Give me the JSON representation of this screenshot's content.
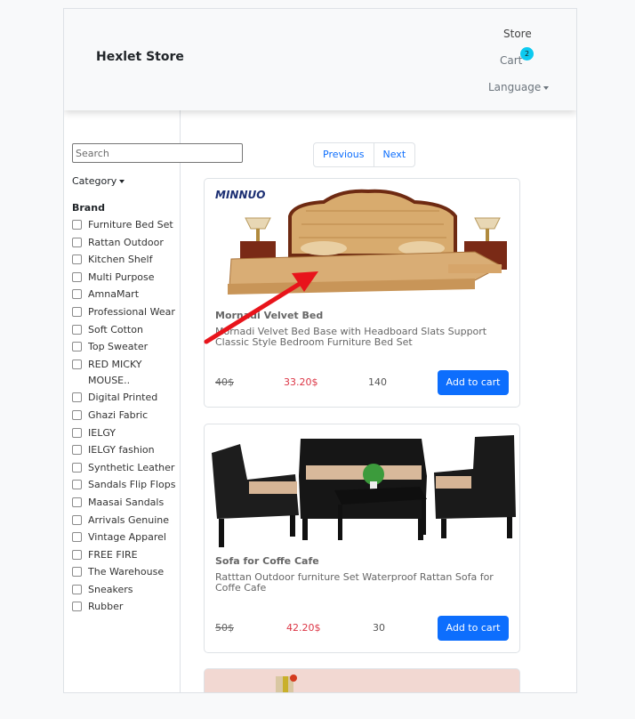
{
  "navbar": {
    "brand": "Hexlet Store",
    "store_link": "Store",
    "cart_link": "Cart",
    "cart_count": "2",
    "language_label": "Language"
  },
  "sidebar": {
    "search_placeholder": "Search",
    "category_label": "Category",
    "brand_heading": "Brand",
    "brands": [
      "Furniture Bed Set",
      "Rattan Outdoor",
      "Kitchen Shelf",
      "Multi Purpose",
      "AmnaMart",
      "Professional Wear",
      "Soft Cotton",
      "Top Sweater",
      "RED MICKY MOUSE..",
      "Digital Printed",
      "Ghazi Fabric",
      "IELGY",
      "IELGY fashion",
      "Synthetic Leather",
      "Sandals Flip Flops",
      "Maasai Sandals",
      "Arrivals Genuine",
      "Vintage Apparel",
      "FREE FIRE",
      "The Warehouse",
      "Sneakers",
      "Rubber"
    ]
  },
  "pagination": {
    "previous": "Previous",
    "next": "Next"
  },
  "products": [
    {
      "title": "Mornadi Velvet Bed",
      "description": "Mornadi Velvet Bed Base with Headboard Slats Support Classic Style Bedroom Furniture Bed Set",
      "old_price": "40$",
      "price": "33.20$",
      "stock": "140",
      "button": "Add to cart",
      "image_logo": "MINNUO"
    },
    {
      "title": "Sofa for Coffe Cafe",
      "description": "Ratttan Outdoor furniture Set Waterproof Rattan Sofa for Coffe Cafe",
      "old_price": "50$",
      "price": "42.20$",
      "stock": "30",
      "button": "Add to cart"
    }
  ],
  "colors": {
    "primary": "#0d6efd",
    "badge": "#0dcaf0",
    "sale_price": "#dc3545",
    "annotation_arrow": "#e8141b"
  },
  "icons": [
    "caret-down-icon",
    "arrow-annotation"
  ]
}
